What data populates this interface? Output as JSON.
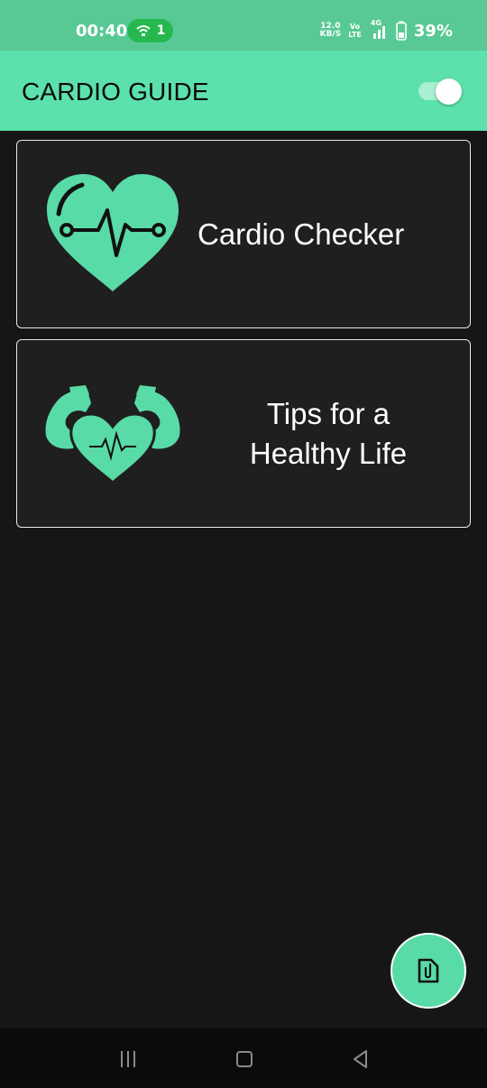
{
  "status_bar": {
    "time": "00:40",
    "hotspot_count": "1",
    "net_speed_value": "12.0",
    "net_speed_unit": "KB/S",
    "volte_top": "Vo",
    "volte_bottom": "LTE",
    "network_type": "4G",
    "battery_percent": "39%"
  },
  "app_bar": {
    "title": "CARDIO GUIDE",
    "toggle_on": true
  },
  "cards": [
    {
      "label": "Cardio Checker",
      "icon": "heart-pulse-icon"
    },
    {
      "label_line1": "Tips for a",
      "label_line2": "Healthy Life",
      "icon": "strong-heart-icon"
    }
  ],
  "fab": {
    "icon": "file-attachment-icon"
  },
  "nav_bar": {
    "buttons": [
      "menu-icon",
      "home-icon",
      "back-icon"
    ]
  },
  "colors": {
    "status_bar": "#58c994",
    "app_bar": "#5ce1ac",
    "accent": "#58dba6",
    "background": "#161616",
    "card": "#1f1f1f"
  }
}
